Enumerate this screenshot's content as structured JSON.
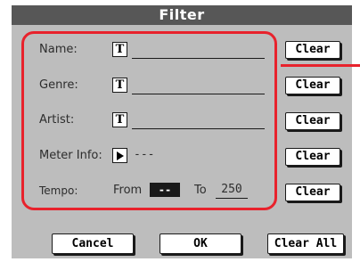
{
  "dialog": {
    "title": "Filter"
  },
  "fields": {
    "name": {
      "label": "Name:",
      "icon_text": "T",
      "value": ""
    },
    "genre": {
      "label": "Genre:",
      "icon_text": "T",
      "value": ""
    },
    "artist": {
      "label": "Artist:",
      "icon_text": "T",
      "value": ""
    },
    "meter": {
      "label": "Meter Info:",
      "value": "---"
    },
    "tempo": {
      "label": "Tempo:",
      "from_label": "From",
      "from_value": "--",
      "to_label": "To",
      "to_value": "250"
    }
  },
  "clear_buttons": [
    "Clear",
    "Clear",
    "Clear",
    "Clear",
    "Clear"
  ],
  "footer": {
    "cancel": "Cancel",
    "ok": "OK",
    "clear_all": "Clear All"
  },
  "colors": {
    "highlight": "#e8222c",
    "titlebar": "#575757",
    "panel": "#bdbdbd"
  }
}
